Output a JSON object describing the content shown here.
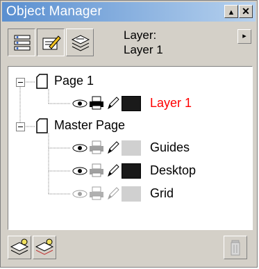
{
  "titlebar": {
    "title": "Object Manager",
    "minimize_glyph": "▲",
    "close_glyph": "✕"
  },
  "toolbar": {
    "layer_prefix": "Layer:",
    "current_layer": "Layer 1",
    "menu_arrow_glyph": "▸",
    "mode_buttons": [
      {
        "icon": "show-object-properties-icon"
      },
      {
        "icon": "edit-across-layers-icon"
      },
      {
        "icon": "layer-manager-view-icon"
      }
    ]
  },
  "tree": {
    "nodes": [
      {
        "label": "Page 1",
        "type": "page",
        "expanded": true
      },
      {
        "label": "Layer 1",
        "type": "layer",
        "color": "#ff0000",
        "swatch": "#1a1a1a",
        "icons_gray": false
      },
      {
        "label": "Master Page",
        "type": "page",
        "expanded": true
      },
      {
        "label": "Guides",
        "type": "layer",
        "color": "#000000",
        "swatch": "#d0d0d0",
        "icons_gray": false
      },
      {
        "label": "Desktop",
        "type": "layer",
        "color": "#000000",
        "swatch": "#1a1a1a",
        "icons_gray": false
      },
      {
        "label": "Grid",
        "type": "layer",
        "color": "#000000",
        "swatch": "#d0d0d0",
        "icons_gray": true
      }
    ]
  },
  "bottom_buttons": [
    {
      "icon": "new-layer-icon"
    },
    {
      "icon": "new-master-layer-icon"
    },
    {
      "icon": "delete-icon"
    }
  ],
  "colors": {
    "panel": "#d4d0c8",
    "title_start": "#5a8fd0",
    "title_end": "#b6d1ee",
    "active_layer": "#ff0000"
  }
}
